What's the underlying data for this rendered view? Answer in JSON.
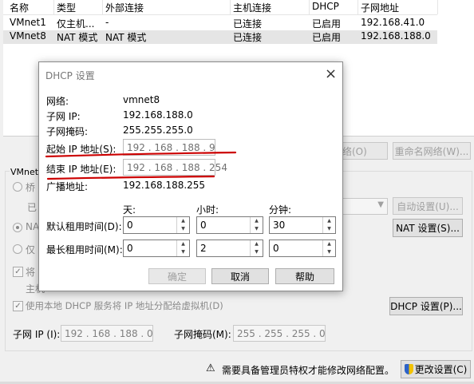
{
  "table": {
    "headers": [
      "名称",
      "类型",
      "外部连接",
      "主机连接",
      "DHCP",
      "子网地址"
    ],
    "rows": [
      [
        "VMnet1",
        "仅主机...",
        "-",
        "已连接",
        "已启用",
        "192.168.41.0"
      ],
      [
        "VMnet8",
        "NAT 模式",
        "NAT 模式",
        "已连接",
        "已启用",
        "192.168.188.0"
      ]
    ]
  },
  "main": {
    "vmnet_info_label": "VMnet 信",
    "bridge_label": "桥",
    "bridge_sub_label": "已",
    "nat_label": "NAT",
    "hostonly_label": "仅",
    "connect_host_label": "将",
    "host_label": "主机",
    "rename_network": "重命名网络(W)...",
    "remove_network": "络(O)",
    "auto_settings": "自动设置(U)...",
    "nat_settings": "NAT 设置(S)...",
    "dhcp_checkbox_label": "使用本地 DHCP 服务将 IP 地址分配给虚拟机(D)",
    "dhcp_settings": "DHCP 设置(P)...",
    "subnet_ip_label": "子网 IP (I):",
    "subnet_ip_value": "192 . 168 . 188 . 0",
    "subnet_mask_label": "子网掩码(M):",
    "subnet_mask_value": "255 . 255 . 255 . 0",
    "admin_notice": "需要具备管理员特权才能修改网络配置。",
    "change_settings": "更改设置(C)"
  },
  "dialog": {
    "title": "DHCP 设置",
    "network_label": "网络:",
    "network_value": "vmnet8",
    "subnet_ip_label": "子网 IP:",
    "subnet_ip_value": "192.168.188.0",
    "subnet_mask_label": "子网掩码:",
    "subnet_mask_value": "255.255.255.0",
    "start_ip_label": "起始 IP 地址(S):",
    "start_ip_value": "192 . 168 . 188 .  9",
    "end_ip_label": "结束 IP 地址(E):",
    "end_ip_value": "192 . 168 . 188 . 254",
    "broadcast_label": "广播地址:",
    "broadcast_value": "192.168.188.255",
    "days_header": "天:",
    "hours_header": "小时:",
    "minutes_header": "分钟:",
    "default_lease_label": "默认租用时间(D):",
    "default_days": "0",
    "default_hours": "0",
    "default_minutes": "30",
    "max_lease_label": "最长租用时间(M):",
    "max_days": "0",
    "max_hours": "2",
    "max_minutes": "0",
    "ok": "确定",
    "cancel": "取消",
    "help": "帮助"
  },
  "colors": {
    "annotation_red": "#cc0000",
    "selection": "#e5e5e5"
  },
  "icons": [
    "close-icon",
    "warning-icon",
    "shield-icon",
    "dropdown-arrow-icon",
    "spin-up-icon",
    "spin-down-icon",
    "check-icon"
  ]
}
